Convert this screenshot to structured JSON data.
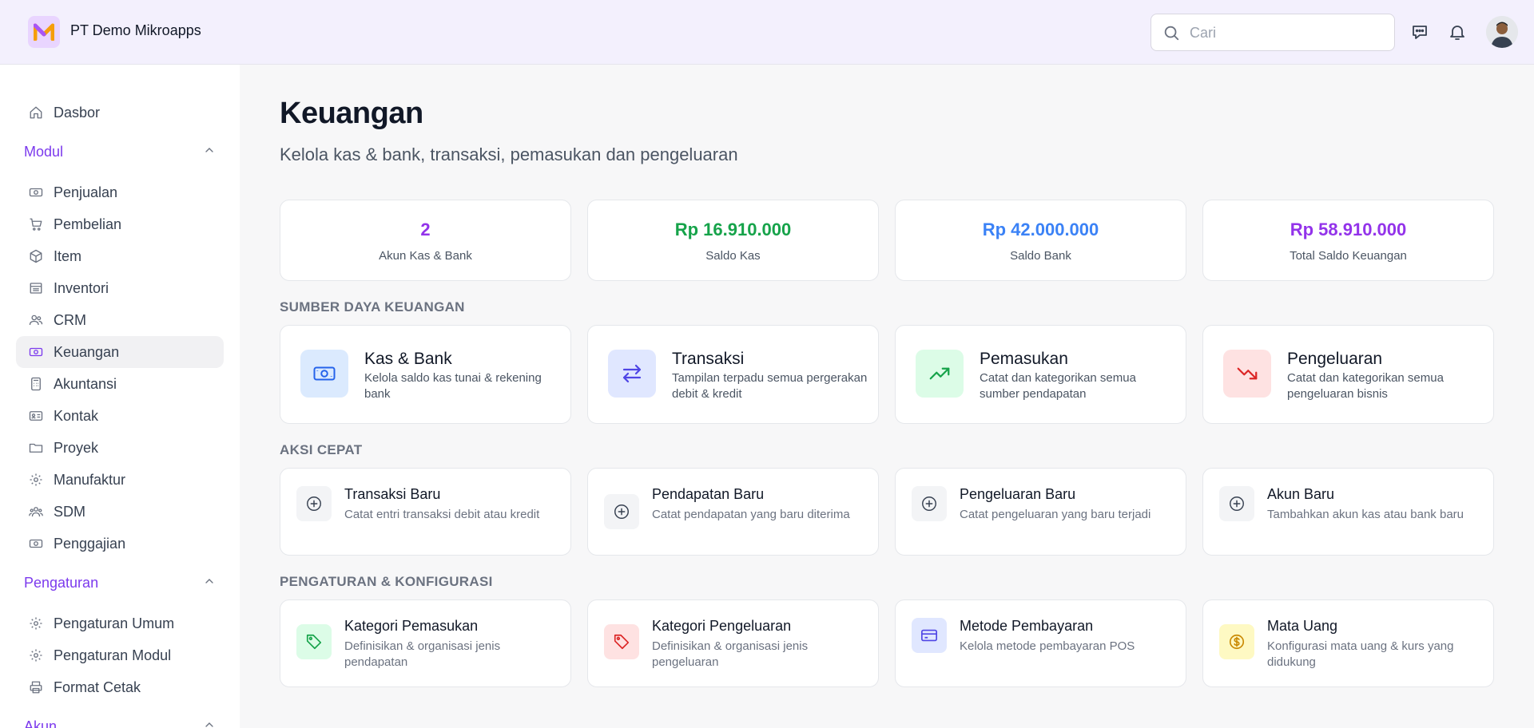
{
  "header": {
    "company": "PT Demo Mikroapps",
    "search_placeholder": "Cari"
  },
  "sidebar": {
    "top": {
      "label": "Dasbor",
      "icon": "home-icon"
    },
    "modul": {
      "label": "Modul",
      "items": [
        {
          "label": "Penjualan",
          "icon": "cash-icon"
        },
        {
          "label": "Pembelian",
          "icon": "cart-icon"
        },
        {
          "label": "Item",
          "icon": "box-icon"
        },
        {
          "label": "Inventori",
          "icon": "warehouse-icon"
        },
        {
          "label": "CRM",
          "icon": "users-icon"
        },
        {
          "label": "Keuangan",
          "icon": "banknote-icon",
          "active": true
        },
        {
          "label": "Akuntansi",
          "icon": "calculator-icon"
        },
        {
          "label": "Kontak",
          "icon": "contact-card-icon"
        },
        {
          "label": "Proyek",
          "icon": "folder-icon"
        },
        {
          "label": "Manufaktur",
          "icon": "gear-icon"
        },
        {
          "label": "SDM",
          "icon": "team-icon"
        },
        {
          "label": "Penggajian",
          "icon": "payroll-icon"
        }
      ]
    },
    "pengaturan": {
      "label": "Pengaturan",
      "items": [
        {
          "label": "Pengaturan Umum",
          "icon": "gear-icon"
        },
        {
          "label": "Pengaturan Modul",
          "icon": "gear-icon"
        },
        {
          "label": "Format Cetak",
          "icon": "printer-icon"
        }
      ]
    },
    "akun": {
      "label": "Akun"
    }
  },
  "main": {
    "title": "Keuangan",
    "subtitle": "Kelola kas & bank, transaksi, pemasukan dan pengeluaran",
    "stats": [
      {
        "value": "2",
        "caption": "Akun Kas & Bank",
        "color": "#9333ea"
      },
      {
        "value": "Rp 16.910.000",
        "caption": "Saldo Kas",
        "color": "#16a34a"
      },
      {
        "value": "Rp 42.000.000",
        "caption": "Saldo Bank",
        "color": "#3b82f6"
      },
      {
        "value": "Rp 58.910.000",
        "caption": "Total Saldo Keuangan",
        "color": "#9333ea"
      }
    ],
    "resources_title": "SUMBER DAYA KEUANGAN",
    "resources": [
      {
        "title": "Kas & Bank",
        "desc": "Kelola saldo kas tunai & rekening bank",
        "icon": "banknote-icon",
        "bg": "#dbeafe",
        "fg": "#2563eb"
      },
      {
        "title": "Transaksi",
        "desc": "Tampilan terpadu semua pergerakan debit & kredit",
        "icon": "arrows-exchange-icon",
        "bg": "#e0e7ff",
        "fg": "#4f46e5"
      },
      {
        "title": "Pemasukan",
        "desc": "Catat dan kategorikan semua sumber pendapatan",
        "icon": "trending-up-icon",
        "bg": "#dcfce7",
        "fg": "#16a34a"
      },
      {
        "title": "Pengeluaran",
        "desc": "Catat dan kategorikan semua pengeluaran bisnis",
        "icon": "trending-down-icon",
        "bg": "#fee2e2",
        "fg": "#dc2626"
      }
    ],
    "quick_title": "AKSI CEPAT",
    "quick": [
      {
        "title": "Transaksi Baru",
        "desc": "Catat entri transaksi debit atau kredit",
        "icon": "plus-circle-icon"
      },
      {
        "title": "Pendapatan Baru",
        "desc": "Catat pendapatan yang baru diterima",
        "icon": "plus-circle-icon"
      },
      {
        "title": "Pengeluaran Baru",
        "desc": "Catat pengeluaran yang baru terjadi",
        "icon": "plus-circle-icon"
      },
      {
        "title": "Akun Baru",
        "desc": "Tambahkan akun kas atau bank baru",
        "icon": "plus-circle-icon"
      }
    ],
    "config_title": "PENGATURAN & KONFIGURASI",
    "config": [
      {
        "title": "Kategori Pemasukan",
        "desc": "Definisikan & organisasi jenis pendapatan",
        "icon": "tag-icon",
        "bg": "#dcfce7",
        "fg": "#16a34a"
      },
      {
        "title": "Kategori Pengeluaran",
        "desc": "Definisikan & organisasi jenis pengeluaran",
        "icon": "tag-icon",
        "bg": "#fee2e2",
        "fg": "#dc2626"
      },
      {
        "title": "Metode Pembayaran",
        "desc": "Kelola metode pembayaran POS",
        "icon": "credit-card-icon",
        "bg": "#e0e7ff",
        "fg": "#4f46e5"
      },
      {
        "title": "Mata Uang",
        "desc": "Konfigurasi mata uang & kurs yang didukung",
        "icon": "dollar-coin-icon",
        "bg": "#fef9c3",
        "fg": "#ca8a04"
      }
    ]
  }
}
